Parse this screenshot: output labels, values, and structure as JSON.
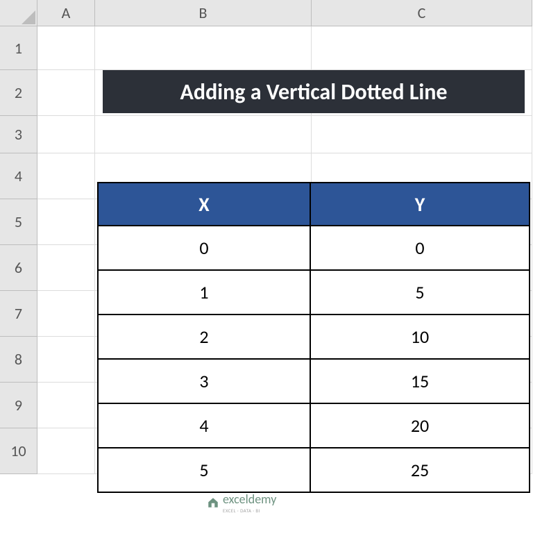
{
  "columns": [
    "A",
    "B",
    "C"
  ],
  "rows": [
    "1",
    "2",
    "3",
    "4",
    "5",
    "6",
    "7",
    "8",
    "9",
    "10"
  ],
  "title": "Adding a Vertical Dotted Line",
  "table": {
    "headers": {
      "x": "X",
      "y": "Y"
    },
    "data": [
      {
        "x": "0",
        "y": "0"
      },
      {
        "x": "1",
        "y": "5"
      },
      {
        "x": "2",
        "y": "10"
      },
      {
        "x": "3",
        "y": "15"
      },
      {
        "x": "4",
        "y": "20"
      },
      {
        "x": "5",
        "y": "25"
      }
    ]
  },
  "watermark": {
    "brand": "exceldemy",
    "tagline": "EXCEL · DATA · BI"
  }
}
